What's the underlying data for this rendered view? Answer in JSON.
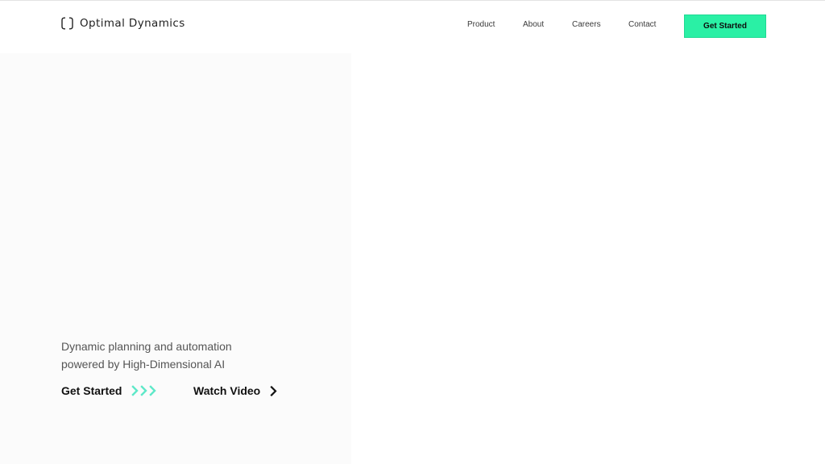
{
  "brand": {
    "name": "Optimal Dynamics",
    "icon": "bracket-logo-icon"
  },
  "nav": {
    "items": [
      {
        "label": "Product"
      },
      {
        "label": "About"
      },
      {
        "label": "Careers"
      },
      {
        "label": "Contact"
      }
    ],
    "cta_label": "Get Started"
  },
  "hero": {
    "tagline_line1": "Dynamic planning and automation",
    "tagline_line2": "powered by High-Dimensional AI",
    "get_started_label": "Get Started",
    "get_started_icon": "triple-chevron-right-icon",
    "watch_video_label": "Watch Video",
    "watch_video_icon": "chevron-right-icon"
  },
  "colors": {
    "accent": "#2af0a5",
    "arrow_accent": "#5ee8c8",
    "panel_background": "#fbfbfb",
    "text": "#111111",
    "muted_text": "#555555"
  }
}
